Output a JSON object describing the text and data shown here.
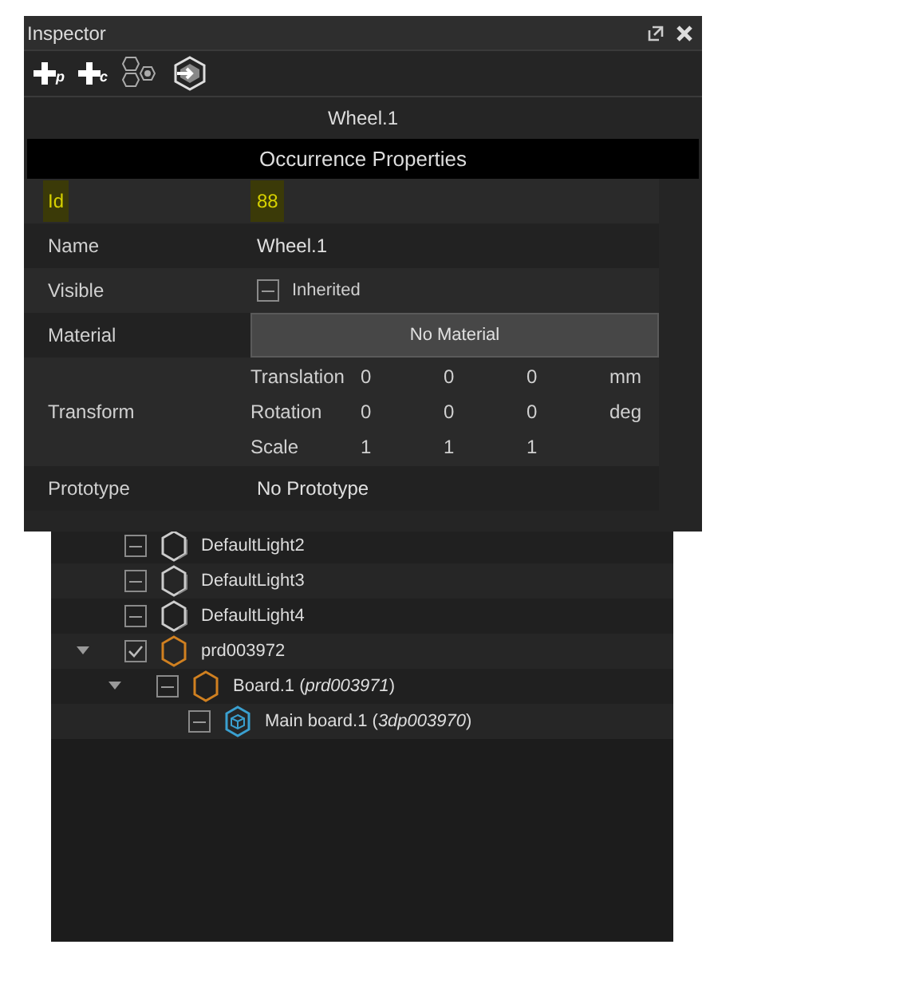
{
  "inspector": {
    "title": "Inspector",
    "toolbar": [
      {
        "kind": "add-p",
        "label": "p"
      },
      {
        "kind": "add-c",
        "label": "c"
      },
      {
        "kind": "hexes"
      },
      {
        "kind": "enter"
      }
    ],
    "header": "Wheel.1",
    "section": "Occurrence Properties",
    "rows": [
      {
        "kind": "text",
        "label": "Id",
        "value": "88",
        "highlighted": true
      },
      {
        "kind": "text",
        "label": "Name",
        "value": "Wheel.1",
        "highlighted": false
      },
      {
        "kind": "check",
        "label": "Visible",
        "value": "Inherited",
        "checked": true,
        "inherited": true
      },
      {
        "kind": "button",
        "label": "Material",
        "value": "No Material"
      },
      {
        "kind": "transform",
        "label": "Transform",
        "lines": [
          {
            "label": "Translation",
            "values": [
              "0",
              "0",
              "0"
            ],
            "unit": "mm"
          },
          {
            "label": "Rotation",
            "values": [
              "0",
              "0",
              "0"
            ],
            "unit": "deg"
          },
          {
            "label": "Scale",
            "values": [
              "1",
              "1",
              "1"
            ]
          }
        ]
      },
      {
        "kind": "text",
        "label": "Prototype",
        "value": "No Prototype",
        "highlighted": false
      }
    ]
  },
  "tree": {
    "items": [
      {
        "label": "DefaultLight2",
        "kind": "light",
        "checked": true,
        "inherited": true
      },
      {
        "label": "DefaultLight3",
        "kind": "light",
        "checked": true,
        "inherited": true
      },
      {
        "label": "DefaultLight4",
        "kind": "light",
        "checked": true,
        "inherited": true
      },
      {
        "label": "prd003972",
        "kind": "product",
        "checked": true,
        "inherited": false,
        "expanded": true,
        "children": [
          {
            "label": "Board.1 (*prd003971*)",
            "kind": "product",
            "checked": true,
            "inherited": true,
            "expanded": true,
            "children": [
              {
                "label": "Main board.1 (*3dp003970*)",
                "kind": "part",
                "checked": true,
                "inherited": true
              }
            ]
          }
        ]
      }
    ]
  }
}
